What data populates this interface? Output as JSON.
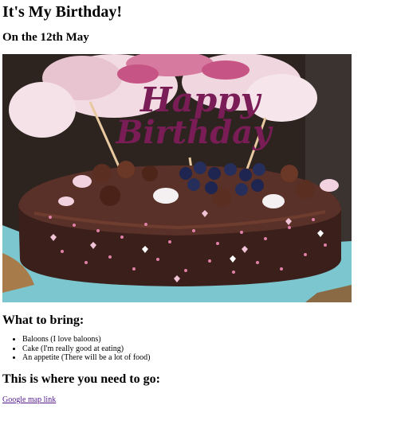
{
  "header": {
    "title": "It's My Birthday!",
    "date": "On the 12th May"
  },
  "image": {
    "topper_line1": "Happy",
    "topper_line2": "Birthday",
    "colors": {
      "topper": "#7a1d57",
      "meringue": "#f2dbe3",
      "chocolate": "#4a2a22",
      "board": "#7cc6cf",
      "blueberry": "#1d2550"
    }
  },
  "bring": {
    "heading": "What to bring:",
    "items": [
      "Baloons (I love baloons)",
      "Cake (I'm really good at eating)",
      "An appetite (There will be a lot of food)"
    ]
  },
  "directions": {
    "heading": "This is where you need to go:",
    "link_text": "Google map link"
  }
}
